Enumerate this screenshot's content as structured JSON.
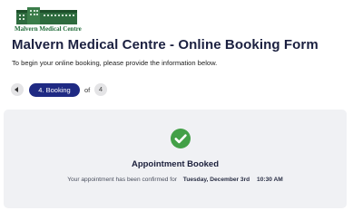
{
  "logo": {
    "text": "Malvern Medical Centre",
    "icon": "building-logo"
  },
  "header": {
    "title": "Malvern Medical Centre - Online Booking Form",
    "subtitle": "To begin your online booking, please provide the information below."
  },
  "pager": {
    "current_step": "4. Booking",
    "of_label": "of",
    "total": "4",
    "accent_color": "#1f2a83"
  },
  "confirmation": {
    "icon": "check-circle-icon",
    "icon_color": "#43a047",
    "heading": "Appointment Booked",
    "message": "Your appointment has been confirmed for",
    "date": "Tuesday, December 3rd",
    "time": "10:30 AM"
  }
}
